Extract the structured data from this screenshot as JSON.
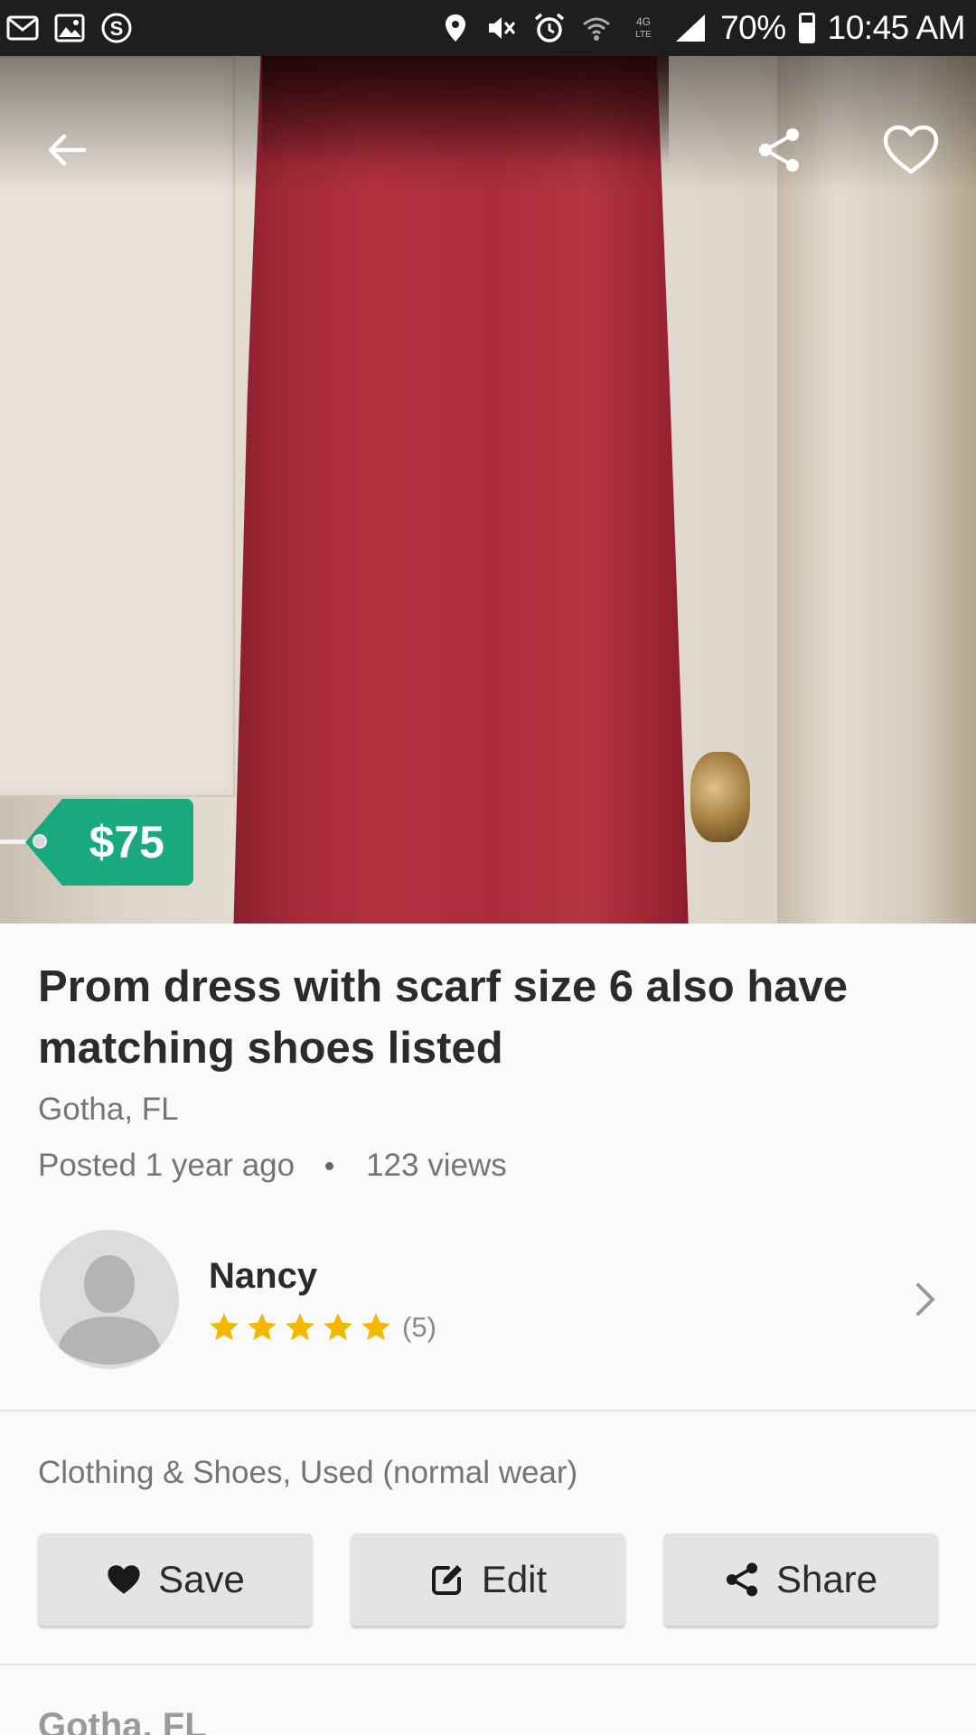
{
  "status_bar": {
    "battery": "70%",
    "time": "10:45 AM"
  },
  "listing": {
    "price": "$75",
    "title": "Prom dress with scarf size 6 also have matching shoes listed",
    "location": "Gotha, FL",
    "posted": "Posted 1 year ago",
    "views": "123 views",
    "category": "Clothing & Shoes, Used (normal wear)",
    "map_location": "Gotha, FL"
  },
  "seller": {
    "name": "Nancy",
    "rating_stars": 5,
    "rating_count": "(5)"
  },
  "actions": {
    "save_label": "Save",
    "edit_label": "Edit",
    "share_label": "Share"
  },
  "colors": {
    "price_tag": "#1aa97c",
    "star": "#f5b800",
    "button_bg": "#e4e4e4"
  },
  "icons": [
    "mail-icon",
    "image-icon",
    "s-app-icon",
    "location-icon",
    "mute-icon",
    "alarm-icon",
    "wifi-icon",
    "lte-icon",
    "signal-icon",
    "battery-icon",
    "back-arrow-icon",
    "share-icon",
    "heart-outline-icon",
    "chevron-right-icon",
    "heart-filled-icon",
    "edit-icon",
    "share-small-icon"
  ]
}
